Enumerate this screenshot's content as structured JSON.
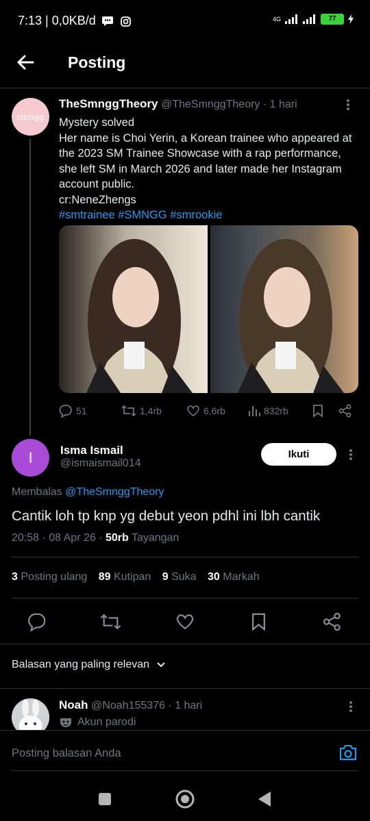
{
  "status_bar": {
    "time_data": "7:13 | 0,0KB/d",
    "network": "4G",
    "battery": "77"
  },
  "header": {
    "title": "Posting"
  },
  "original_tweet": {
    "name": "TheSmnggTheory",
    "handle_time": "@TheSmnggTheory · 1 hari",
    "avatar_text": "smngg",
    "lines": [
      "Mystery solved",
      "Her name is Choi Yerin, a Korean trainee who appeared at",
      "the 2023 SM Trainee Showcase with a rap performance,",
      "she left SM in March 2026 and later made her Instagram",
      "account public.",
      "cr:NeneZhengs"
    ],
    "hashtags": "#smtrainee #SMNGG #smrookie",
    "replies": "51",
    "reposts": "1,4rb",
    "likes": "6,6rb",
    "views": "832rb"
  },
  "main_tweet": {
    "avatar_letter": "I",
    "name": "Isma Ismail",
    "handle": "@ismaismail014",
    "follow_label": "Ikuti",
    "reply_to_prefix": "Membalas ",
    "reply_to_handle": "@TheSmnggTheory",
    "text": "Cantik loh tp knp yg debut yeon pdhl ini lbh cantik",
    "timestamp": "20:58 · 08 Apr 26 · ",
    "views_count": "50rb",
    "views_label": " Tayangan",
    "stats": [
      {
        "count": "3",
        "label": "Posting ulang"
      },
      {
        "count": "89",
        "label": "Kutipan"
      },
      {
        "count": "9",
        "label": "Suka"
      },
      {
        "count": "30",
        "label": "Markah"
      }
    ]
  },
  "sort": {
    "label": "Balasan yang paling relevan"
  },
  "reply": {
    "name": "Noah",
    "handle_time": "@Noah155376 · 1 hari",
    "badge": "Akun parodi"
  },
  "composer": {
    "placeholder": "Posting balasan Anda"
  },
  "colors": {
    "accent": "#1d9bf0",
    "background": "#000000",
    "avatar_purple": "#a94ad9"
  }
}
